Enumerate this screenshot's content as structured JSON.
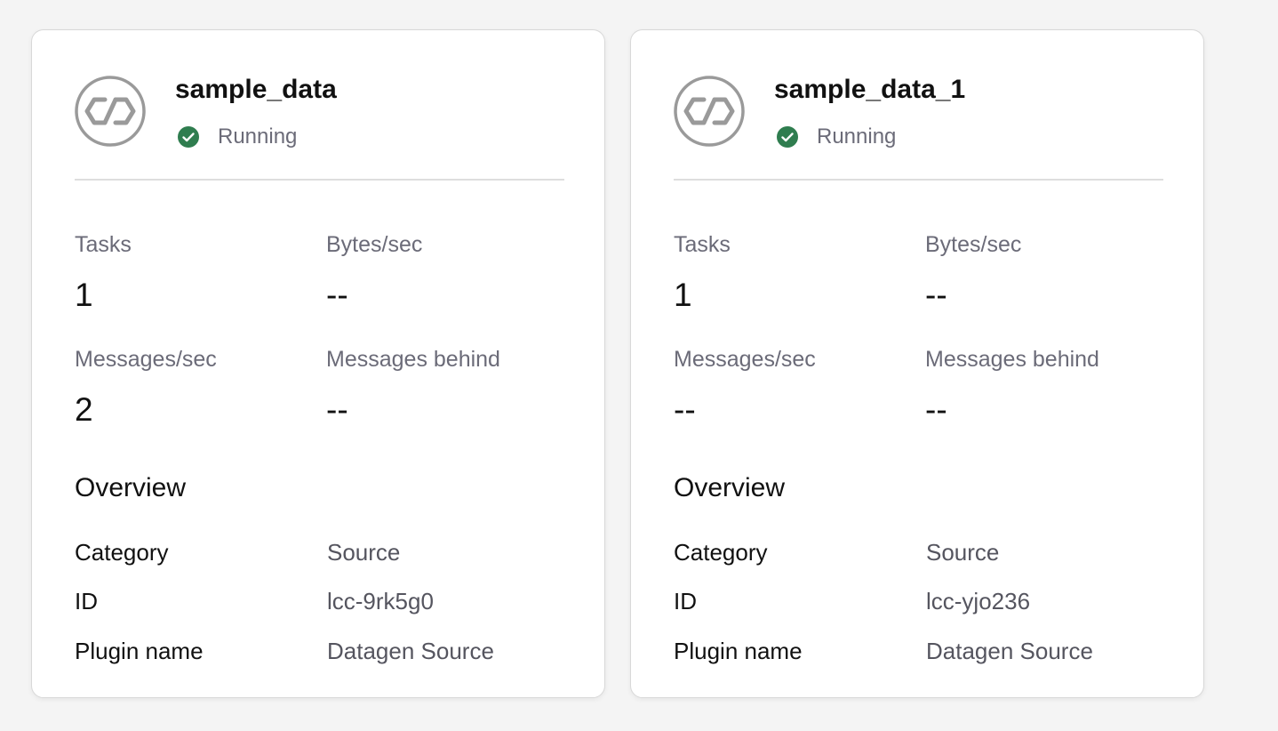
{
  "colors": {
    "page_bg": "#f4f4f4",
    "card_bg": "#ffffff",
    "status_running": "#2f7d4f",
    "muted_text": "#6b6b78",
    "logo_gray": "#9a9a9a"
  },
  "cards": [
    {
      "icon": "connector-icon",
      "name": "sample_data",
      "status": {
        "icon": "check-circle-icon",
        "label": "Running"
      },
      "metrics": {
        "tasks": {
          "label": "Tasks",
          "value": "1"
        },
        "bytes_sec": {
          "label": "Bytes/sec",
          "value": "--"
        },
        "messages_sec": {
          "label": "Messages/sec",
          "value": "2"
        },
        "messages_behind": {
          "label": "Messages behind",
          "value": "--"
        }
      },
      "overview": {
        "title": "Overview",
        "rows": [
          {
            "key": "Category",
            "value": "Source"
          },
          {
            "key": "ID",
            "value": "lcc-9rk5g0"
          },
          {
            "key": "Plugin name",
            "value": "Datagen Source"
          }
        ]
      }
    },
    {
      "icon": "connector-icon",
      "name": "sample_data_1",
      "status": {
        "icon": "check-circle-icon",
        "label": "Running"
      },
      "metrics": {
        "tasks": {
          "label": "Tasks",
          "value": "1"
        },
        "bytes_sec": {
          "label": "Bytes/sec",
          "value": "--"
        },
        "messages_sec": {
          "label": "Messages/sec",
          "value": "--"
        },
        "messages_behind": {
          "label": "Messages behind",
          "value": "--"
        }
      },
      "overview": {
        "title": "Overview",
        "rows": [
          {
            "key": "Category",
            "value": "Source"
          },
          {
            "key": "ID",
            "value": "lcc-yjo236"
          },
          {
            "key": "Plugin name",
            "value": "Datagen Source"
          }
        ]
      }
    }
  ]
}
